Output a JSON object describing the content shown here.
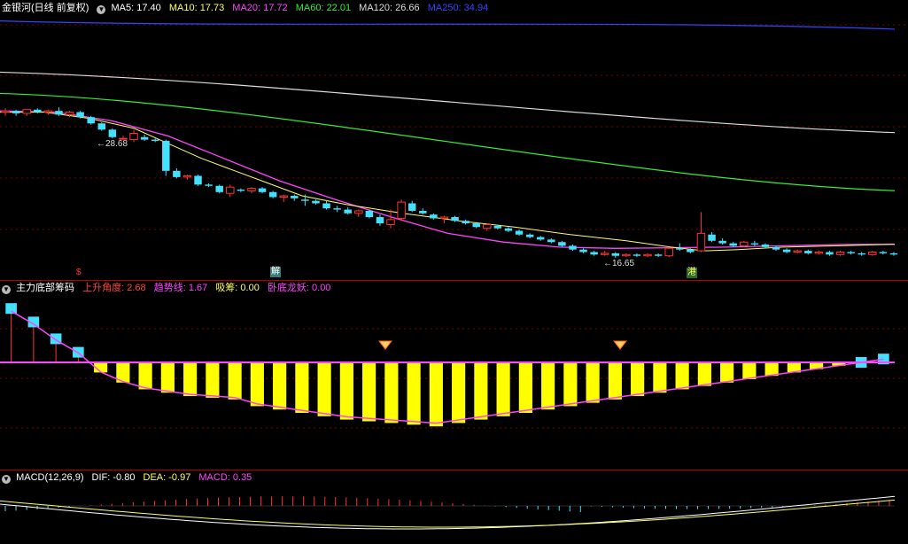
{
  "main": {
    "title": "金银河(日线 前复权)",
    "ma": [
      {
        "label": "MA5: 17.40",
        "color": "#ffffff"
      },
      {
        "label": "MA10: 17.73",
        "color": "#ffff66"
      },
      {
        "label": "MA20: 17.72",
        "color": "#ff44ff"
      },
      {
        "label": "MA60: 22.01",
        "color": "#33ee33"
      },
      {
        "label": "MA120: 26.66",
        "color": "#dddddd"
      },
      {
        "label": "MA250: 34.94",
        "color": "#3344ff"
      }
    ],
    "high_label": "28.68",
    "low_label": "16.65",
    "markers": [
      {
        "text": "$",
        "color": "#ff3333",
        "bg": ""
      },
      {
        "text": "解",
        "color": "#ffffff",
        "bg": "#3a7a7a"
      },
      {
        "text": "港",
        "color": "#ffff66",
        "bg": "#2a6a2a"
      }
    ]
  },
  "sub1": {
    "title": "主力底部筹码",
    "items": [
      {
        "label": "上升角度: 2.68",
        "color": "#ff4444"
      },
      {
        "label": "趋势线: 1.67",
        "color": "#ff44ff"
      },
      {
        "label": "吸筹: 0.00",
        "color": "#ffff66"
      },
      {
        "label": "卧底龙妖: 0.00",
        "color": "#ff44ff"
      }
    ]
  },
  "sub2": {
    "title": "MACD(12,26,9)",
    "items": [
      {
        "label": "DIF: -0.80",
        "color": "#ffffff"
      },
      {
        "label": "DEA: -0.97",
        "color": "#ffff66"
      },
      {
        "label": "MACD: 0.35",
        "color": "#ff44ff"
      }
    ]
  },
  "chart_data": {
    "type": "candlestick",
    "ylim": [
      16,
      36
    ],
    "candles": [
      [
        28.3,
        28.6,
        28.0,
        28.4
      ],
      [
        28.4,
        28.5,
        28.0,
        28.2
      ],
      [
        28.2,
        28.5,
        28.0,
        28.5
      ],
      [
        28.5,
        28.6,
        28.2,
        28.3
      ],
      [
        28.3,
        28.5,
        28.1,
        28.4
      ],
      [
        28.4,
        28.68,
        28.0,
        28.1
      ],
      [
        28.1,
        28.4,
        27.9,
        28.3
      ],
      [
        28.3,
        28.4,
        27.8,
        27.9
      ],
      [
        27.9,
        28.0,
        27.3,
        27.4
      ],
      [
        27.4,
        27.5,
        26.8,
        26.9
      ],
      [
        26.9,
        27.0,
        26.2,
        26.3
      ],
      [
        26.2,
        26.4,
        26.1,
        26.2
      ],
      [
        26.1,
        26.9,
        25.9,
        26.6
      ],
      [
        26.3,
        26.5,
        26.0,
        26.1
      ],
      [
        26.1,
        26.2,
        25.9,
        26.0
      ],
      [
        26.0,
        26.1,
        23.2,
        23.6
      ],
      [
        23.6,
        23.8,
        23.0,
        23.1
      ],
      [
        23.1,
        23.3,
        22.9,
        23.2
      ],
      [
        23.2,
        23.3,
        22.4,
        22.5
      ],
      [
        22.5,
        22.6,
        22.3,
        22.4
      ],
      [
        22.4,
        22.5,
        21.8,
        21.9
      ],
      [
        21.8,
        22.5,
        21.5,
        22.3
      ],
      [
        22.1,
        22.2,
        21.9,
        22.0
      ],
      [
        22.0,
        22.3,
        21.8,
        22.2
      ],
      [
        22.2,
        22.3,
        21.8,
        21.9
      ],
      [
        21.9,
        22.0,
        21.4,
        21.5
      ],
      [
        21.5,
        21.7,
        21.1,
        21.6
      ],
      [
        21.6,
        21.7,
        21.2,
        21.4
      ],
      [
        21.3,
        21.7,
        20.8,
        21.2
      ],
      [
        21.2,
        21.3,
        20.9,
        21.0
      ],
      [
        21.0,
        21.2,
        20.5,
        20.6
      ],
      [
        20.6,
        20.8,
        20.3,
        20.5
      ],
      [
        20.5,
        20.7,
        20.1,
        20.2
      ],
      [
        20.2,
        20.5,
        19.9,
        20.4
      ],
      [
        20.4,
        20.5,
        19.8,
        19.9
      ],
      [
        19.9,
        20.1,
        19.2,
        19.4
      ],
      [
        19.3,
        20.5,
        19.0,
        19.7
      ],
      [
        19.8,
        21.3,
        19.6,
        21.1
      ],
      [
        21.0,
        21.2,
        20.3,
        20.4
      ],
      [
        20.4,
        20.6,
        20.1,
        20.2
      ],
      [
        20.1,
        20.2,
        19.7,
        19.8
      ],
      [
        19.8,
        20.0,
        19.4,
        19.9
      ],
      [
        19.9,
        20.0,
        19.5,
        19.6
      ],
      [
        19.6,
        19.7,
        19.3,
        19.4
      ],
      [
        19.4,
        19.5,
        19.0,
        19.1
      ],
      [
        19.0,
        19.4,
        18.8,
        19.3
      ],
      [
        19.2,
        19.3,
        18.9,
        19.0
      ],
      [
        19.0,
        19.1,
        18.7,
        18.8
      ],
      [
        18.8,
        18.9,
        18.4,
        18.5
      ],
      [
        18.5,
        18.6,
        18.2,
        18.3
      ],
      [
        18.3,
        18.4,
        18.0,
        18.1
      ],
      [
        18.1,
        18.2,
        17.8,
        17.9
      ],
      [
        17.9,
        18.0,
        17.5,
        17.6
      ],
      [
        17.6,
        17.7,
        17.2,
        17.3
      ],
      [
        17.3,
        17.4,
        17.0,
        17.1
      ],
      [
        17.1,
        17.2,
        16.8,
        16.9
      ],
      [
        16.9,
        17.2,
        16.8,
        17.0
      ],
      [
        17.0,
        17.1,
        16.65,
        16.8
      ],
      [
        16.8,
        17.0,
        16.7,
        16.9
      ],
      [
        16.9,
        17.0,
        16.7,
        16.8
      ],
      [
        16.8,
        17.0,
        16.7,
        16.9
      ],
      [
        16.9,
        17.0,
        16.7,
        16.8
      ],
      [
        16.8,
        17.5,
        16.7,
        17.4
      ],
      [
        17.4,
        17.8,
        17.2,
        17.3
      ],
      [
        17.3,
        17.4,
        17.0,
        17.1
      ],
      [
        17.2,
        20.3,
        17.1,
        18.6
      ],
      [
        18.5,
        18.7,
        17.9,
        18.0
      ],
      [
        18.0,
        18.2,
        17.7,
        17.8
      ],
      [
        17.8,
        17.9,
        17.5,
        17.6
      ],
      [
        17.6,
        18.0,
        17.5,
        17.9
      ],
      [
        17.8,
        18.0,
        17.6,
        17.7
      ],
      [
        17.7,
        17.8,
        17.4,
        17.5
      ],
      [
        17.5,
        17.6,
        17.2,
        17.3
      ],
      [
        17.3,
        17.4,
        17.0,
        17.1
      ],
      [
        17.1,
        17.3,
        17.0,
        17.2
      ],
      [
        17.2,
        17.3,
        16.9,
        17.0
      ],
      [
        17.0,
        17.2,
        16.9,
        17.1
      ],
      [
        17.1,
        17.2,
        16.8,
        16.9
      ],
      [
        16.9,
        17.2,
        16.8,
        17.1
      ],
      [
        17.1,
        17.2,
        16.9,
        17.0
      ],
      [
        17.0,
        17.1,
        16.8,
        16.9
      ],
      [
        16.9,
        17.2,
        16.8,
        17.1
      ],
      [
        17.1,
        17.2,
        16.9,
        17.0
      ],
      [
        17.0,
        17.1,
        16.8,
        16.9
      ]
    ],
    "ma_lines": {
      "MA250": [
        35.6,
        34.94
      ],
      "MA120": [
        31.5,
        26.66
      ],
      "MA60": [
        29.8,
        22.01
      ],
      "MA20": [
        [
          0,
          28.4
        ],
        [
          10,
          28.3
        ],
        [
          20,
          27.6
        ],
        [
          30,
          26.4
        ],
        [
          40,
          24.6
        ],
        [
          50,
          22.8
        ],
        [
          60,
          21.3
        ],
        [
          70,
          19.9
        ],
        [
          80,
          18.6
        ],
        [
          90,
          17.9
        ],
        [
          100,
          17.5
        ],
        [
          110,
          17.4
        ],
        [
          120,
          17.45
        ],
        [
          130,
          17.5
        ],
        [
          140,
          17.6
        ],
        [
          150,
          17.7
        ],
        [
          160,
          17.72
        ]
      ],
      "MA10": [
        [
          0,
          28.3
        ],
        [
          8,
          28.3
        ],
        [
          16,
          27.8
        ],
        [
          24,
          27.0
        ],
        [
          30,
          25.8
        ],
        [
          36,
          24.6
        ],
        [
          42,
          23.6
        ],
        [
          48,
          22.6
        ],
        [
          54,
          21.6
        ],
        [
          62,
          20.9
        ],
        [
          72,
          20.2
        ],
        [
          82,
          19.6
        ],
        [
          92,
          19.1
        ],
        [
          102,
          18.5
        ],
        [
          112,
          18.0
        ],
        [
          120,
          17.5
        ],
        [
          126,
          17.2
        ],
        [
          132,
          17.3
        ],
        [
          140,
          17.5
        ],
        [
          150,
          17.6
        ],
        [
          160,
          17.73
        ]
      ]
    },
    "sub1_bars": [
      1.6,
      1.2,
      0.7,
      0.3,
      -0.3,
      -0.6,
      -0.8,
      -0.9,
      -1.0,
      -1.05,
      -1.1,
      -1.3,
      -1.4,
      -1.5,
      -1.6,
      -1.7,
      -1.75,
      -1.8,
      -1.85,
      -1.9,
      -1.8,
      -1.7,
      -1.6,
      -1.5,
      -1.4,
      -1.3,
      -1.2,
      -1.1,
      -1.0,
      -0.9,
      -0.8,
      -0.7,
      -0.6,
      -0.5,
      -0.4,
      -0.3,
      -0.2,
      -0.1,
      0.0,
      0.1
    ],
    "macd": {
      "DIF": -0.8,
      "DEA": -0.97,
      "MACD": 0.35
    }
  }
}
